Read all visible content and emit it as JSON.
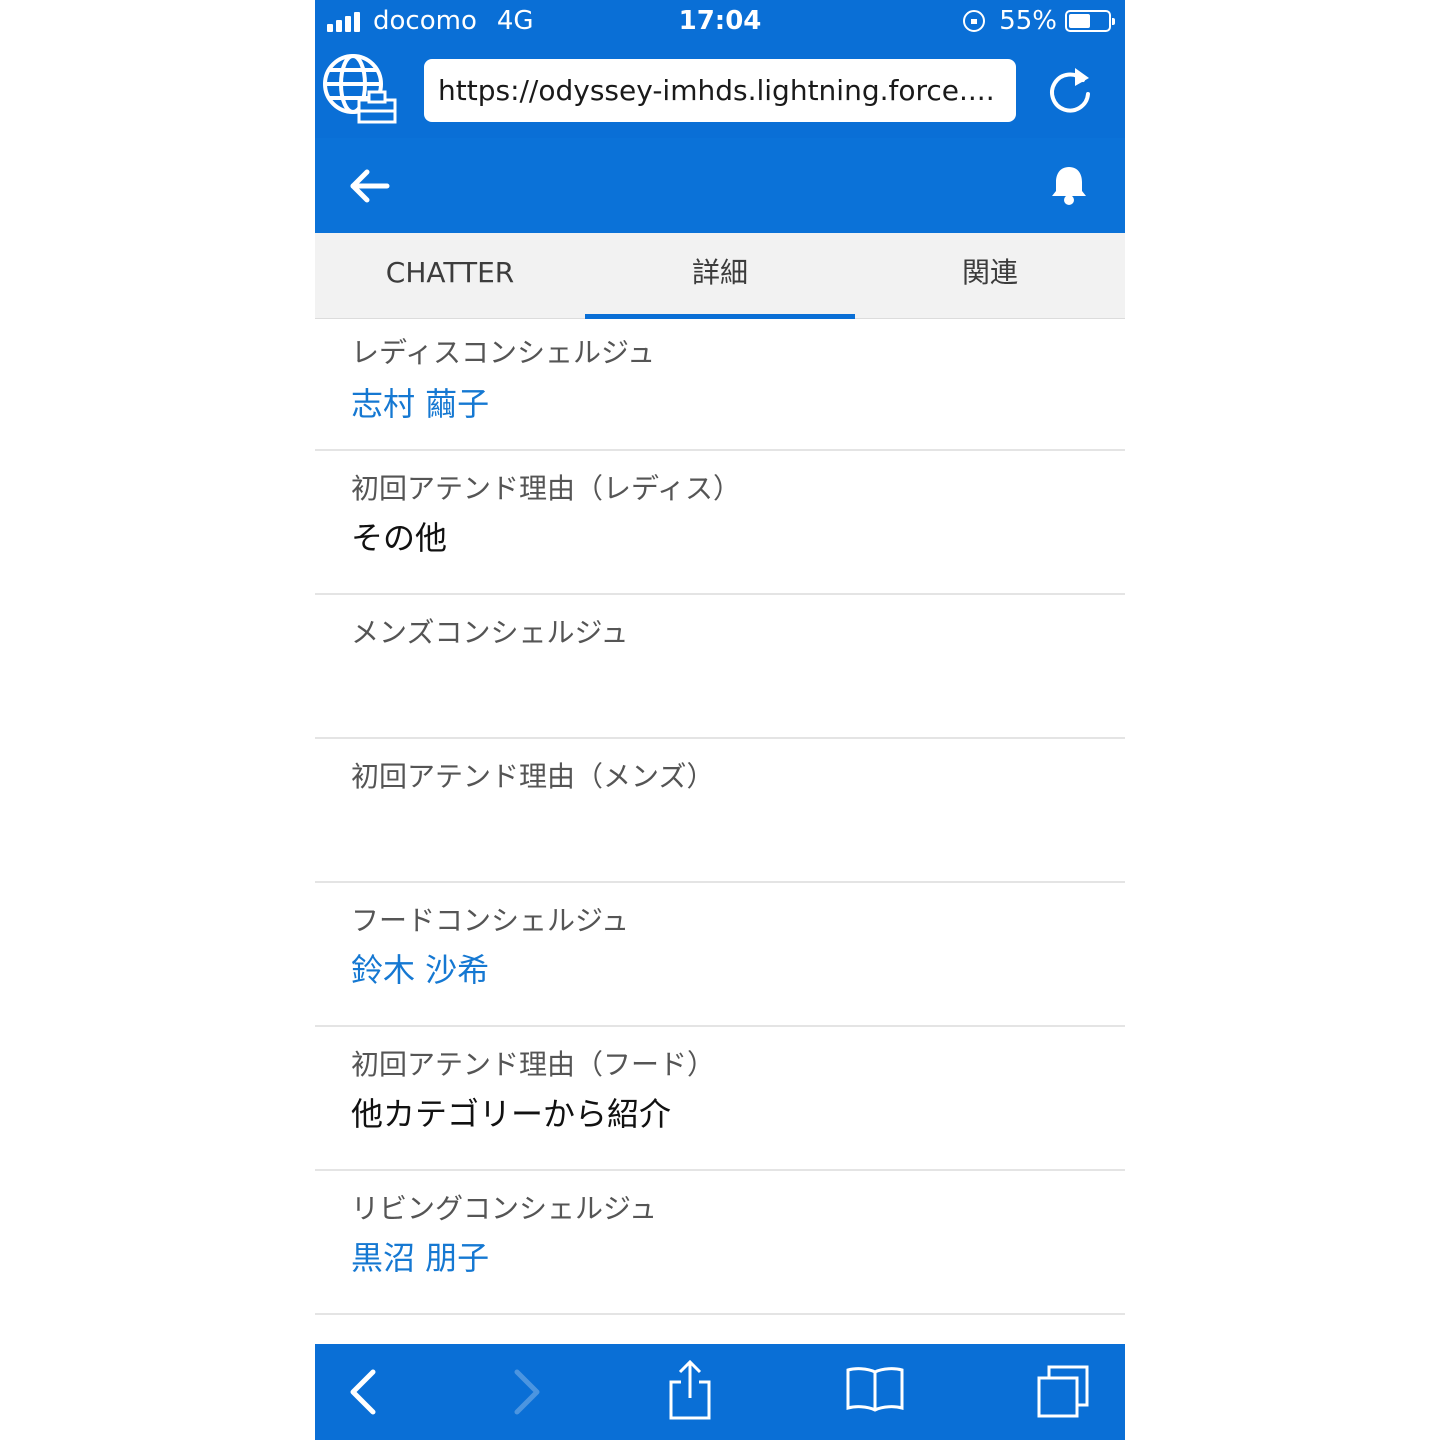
{
  "status_bar": {
    "carrier": "docomo",
    "network": "4G",
    "time": "17:04",
    "battery_percent": "55%",
    "battery_level": 0.55
  },
  "browser": {
    "url": "https://odyssey-imhds.lightning.force...."
  },
  "tabs": [
    {
      "label": "CHATTER",
      "active": false
    },
    {
      "label": "詳細",
      "active": true
    },
    {
      "label": "関連",
      "active": false
    }
  ],
  "fields": [
    {
      "label": "レディスコンシェルジュ",
      "value": "志村 繭子",
      "is_link": true
    },
    {
      "label": "初回アテンド理由（レディス）",
      "value": "その他",
      "is_link": false
    },
    {
      "label": "メンズコンシェルジュ",
      "value": "",
      "is_link": false
    },
    {
      "label": "初回アテンド理由（メンズ）",
      "value": "",
      "is_link": false
    },
    {
      "label": "フードコンシェルジュ",
      "value": "鈴木 沙希",
      "is_link": true
    },
    {
      "label": "初回アテンド理由（フード）",
      "value": "他カテゴリーから紹介",
      "is_link": false
    },
    {
      "label": "リビングコンシェルジュ",
      "value": "黒沼 朋子",
      "is_link": true
    }
  ],
  "colors": {
    "brand_blue": "#0a6fd6",
    "link_blue": "#1578d2",
    "tab_bg": "#f2f2f2"
  },
  "icons": {
    "header_left": "back-arrow-icon",
    "header_right": "bell-icon",
    "browser_left": "globe-icon",
    "browser_right": "reload-icon",
    "toolbar": [
      "back-chevron-icon",
      "forward-chevron-icon",
      "share-icon",
      "bookmarks-icon",
      "tabs-icon"
    ]
  }
}
